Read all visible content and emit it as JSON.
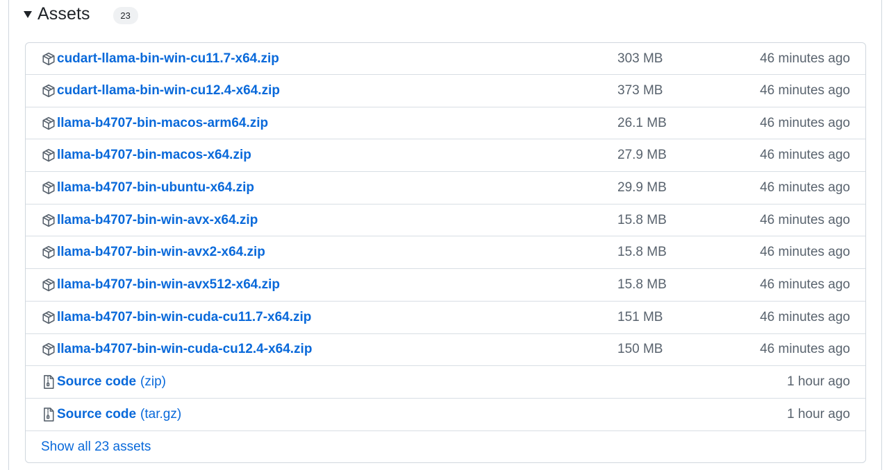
{
  "assets": {
    "title": "Assets",
    "count": "23",
    "items": [
      {
        "name": "cudart-llama-bin-win-cu11.7-x64.zip",
        "suffix": "",
        "size": "303 MB",
        "time": "46 minutes ago",
        "icon": "package-icon"
      },
      {
        "name": "cudart-llama-bin-win-cu12.4-x64.zip",
        "suffix": "",
        "size": "373 MB",
        "time": "46 minutes ago",
        "icon": "package-icon"
      },
      {
        "name": "llama-b4707-bin-macos-arm64.zip",
        "suffix": "",
        "size": "26.1 MB",
        "time": "46 minutes ago",
        "icon": "package-icon"
      },
      {
        "name": "llama-b4707-bin-macos-x64.zip",
        "suffix": "",
        "size": "27.9 MB",
        "time": "46 minutes ago",
        "icon": "package-icon"
      },
      {
        "name": "llama-b4707-bin-ubuntu-x64.zip",
        "suffix": "",
        "size": "29.9 MB",
        "time": "46 minutes ago",
        "icon": "package-icon"
      },
      {
        "name": "llama-b4707-bin-win-avx-x64.zip",
        "suffix": "",
        "size": "15.8 MB",
        "time": "46 minutes ago",
        "icon": "package-icon"
      },
      {
        "name": "llama-b4707-bin-win-avx2-x64.zip",
        "suffix": "",
        "size": "15.8 MB",
        "time": "46 minutes ago",
        "icon": "package-icon"
      },
      {
        "name": "llama-b4707-bin-win-avx512-x64.zip",
        "suffix": "",
        "size": "15.8 MB",
        "time": "46 minutes ago",
        "icon": "package-icon"
      },
      {
        "name": "llama-b4707-bin-win-cuda-cu11.7-x64.zip",
        "suffix": "",
        "size": "151 MB",
        "time": "46 minutes ago",
        "icon": "package-icon"
      },
      {
        "name": "llama-b4707-bin-win-cuda-cu12.4-x64.zip",
        "suffix": "",
        "size": "150 MB",
        "time": "46 minutes ago",
        "icon": "package-icon"
      },
      {
        "name": "Source code",
        "suffix": "(zip)",
        "size": "",
        "time": "1 hour ago",
        "icon": "file-zip-icon"
      },
      {
        "name": "Source code",
        "suffix": "(tar.gz)",
        "size": "",
        "time": "1 hour ago",
        "icon": "file-zip-icon"
      }
    ],
    "show_all_label": "Show all 23 assets"
  },
  "colors": {
    "link": "#0969da",
    "muted": "#59636e",
    "border": "#d0d7de"
  }
}
